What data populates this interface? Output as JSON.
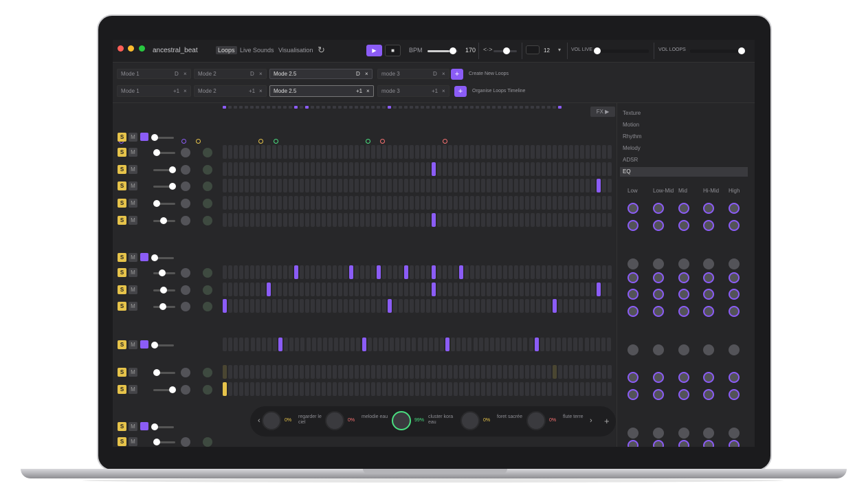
{
  "app": {
    "title": "ancestral_beat"
  },
  "nav": {
    "tabs": [
      "Loops",
      "Live Sounds",
      "Visualisation"
    ],
    "active": "Loops"
  },
  "transport": {
    "bpm_label": "BPM",
    "bpm_value": "170",
    "bpm_fraction": 0.85,
    "swing_fraction": 0.5,
    "steps_value": "12",
    "vol_live_label": "VOL LIVE",
    "vol_live": 0.0,
    "vol_loops_label": "VOL LOOPS",
    "vol_loops": 1.0
  },
  "modes_row1": [
    {
      "label": "Mode 1",
      "d": "D",
      "x": "×"
    },
    {
      "label": "Mode 2",
      "d": "D",
      "x": "×"
    },
    {
      "label": "Mode 2.5",
      "d": "D",
      "x": "×"
    },
    {
      "label": "mode 3",
      "d": "D",
      "x": "×"
    }
  ],
  "modes_row2": [
    {
      "label": "Mode 1",
      "count": "+1",
      "x": "×"
    },
    {
      "label": "Mode 2",
      "count": "+1",
      "x": "×"
    },
    {
      "label": "Mode 2.5",
      "count": "+1",
      "x": "×"
    },
    {
      "label": "mode 3",
      "count": "+1",
      "x": "×"
    }
  ],
  "create_loops": {
    "plus": "+",
    "label": "Create New Loops"
  },
  "organise": {
    "plus": "+",
    "label": "Organise Loops Timeline"
  },
  "fx": {
    "label": "FX ▶"
  },
  "sidebar": {
    "items": [
      "Texture",
      "Motion",
      "Rhythm",
      "Melody",
      "ADSR",
      "EQ"
    ],
    "selected": "EQ",
    "eq_bands": [
      "Low",
      "Low-Mid",
      "Mid",
      "Hi-Mid",
      "High"
    ]
  },
  "track_buttons": {
    "solo": "S",
    "mute": "M"
  },
  "bottom": {
    "prev": "‹",
    "next": "›",
    "add": "+",
    "knobs": [
      {
        "value": "0%",
        "label": "regarder le ciel",
        "color": "#e6c34a"
      },
      {
        "value": "0%",
        "label": "melodie eau",
        "color": "#f87171"
      },
      {
        "value": "99%",
        "label": "cluster kora eau",
        "color": "#4ade80"
      },
      {
        "value": "0%",
        "label": "foret sacrée",
        "color": "#e6c34a"
      },
      {
        "value": "0%",
        "label": "flute terre",
        "color": "#f87171"
      }
    ]
  },
  "colors": {
    "accent": "#8b5cf6",
    "solo": "#e6c34a",
    "green": "#4ade80",
    "red": "#f87171"
  }
}
